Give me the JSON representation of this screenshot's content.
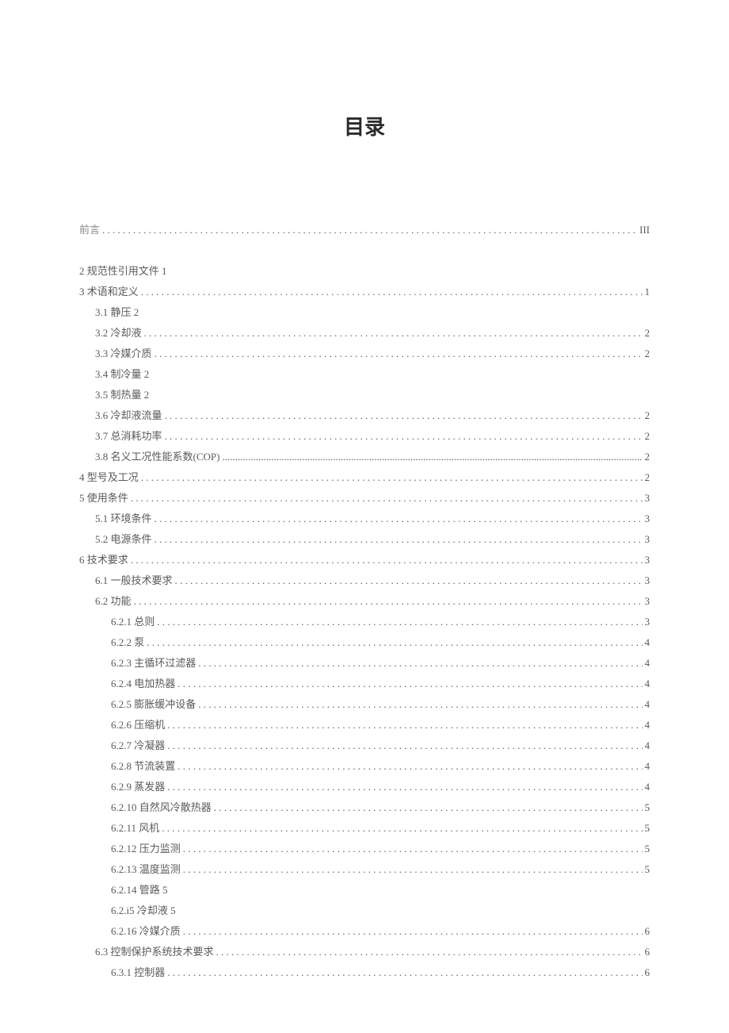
{
  "title": "目录",
  "entries": [
    {
      "label": "前言",
      "page": "III",
      "level": 0,
      "dots": true,
      "preface": true
    },
    {
      "label": "2 规范性引用文件 1",
      "page": "",
      "level": 0,
      "dots": false
    },
    {
      "label": "3 术语和定义",
      "page": "1",
      "level": 0,
      "dots": true
    },
    {
      "label": "3.1 静压 2",
      "page": "",
      "level": 1,
      "dots": false
    },
    {
      "label": "3.2 冷却液",
      "page": "2",
      "level": 1,
      "dots": true
    },
    {
      "label": "3.3 冷媒介质",
      "page": "2",
      "level": 1,
      "dots": true
    },
    {
      "label": "3.4 制冷量 2",
      "page": "",
      "level": 1,
      "dots": false
    },
    {
      "label": "3.5 制热量 2",
      "page": "",
      "level": 1,
      "dots": false
    },
    {
      "label": "3.6 冷却液流量",
      "page": "2",
      "level": 1,
      "dots": true
    },
    {
      "label": "3.7 总消耗功率",
      "page": "2",
      "level": 1,
      "dots": true
    },
    {
      "label": "3.8 名义工况性能系数(COP)",
      "page": "2",
      "level": 1,
      "dots": true,
      "tight": true
    },
    {
      "label": "4 型号及工况",
      "page": "2",
      "level": 0,
      "dots": true
    },
    {
      "label": "5 使用条件",
      "page": "3",
      "level": 0,
      "dots": true
    },
    {
      "label": "5.1 环境条件",
      "page": "3",
      "level": 1,
      "dots": true
    },
    {
      "label": "5.2 电源条件",
      "page": "3",
      "level": 1,
      "dots": true
    },
    {
      "label": "6 技术要求",
      "page": "3",
      "level": 0,
      "dots": true
    },
    {
      "label": "6.1 一般技术要求",
      "page": "3",
      "level": 1,
      "dots": true
    },
    {
      "label": "6.2 功能",
      "page": "3",
      "level": 1,
      "dots": true
    },
    {
      "label": "6.2.1 总则",
      "page": "3",
      "level": 2,
      "dots": true
    },
    {
      "label": "6.2.2 泵",
      "page": "4",
      "level": 2,
      "dots": true
    },
    {
      "label": "6.2.3 主循环过滤器",
      "page": "4",
      "level": 2,
      "dots": true
    },
    {
      "label": "6.2.4 电加热器",
      "page": "4",
      "level": 2,
      "dots": true
    },
    {
      "label": "6.2.5 膨胀缓冲设备",
      "page": "4",
      "level": 2,
      "dots": true
    },
    {
      "label": "6.2.6 压缩机",
      "page": "4",
      "level": 2,
      "dots": true
    },
    {
      "label": "6.2.7 冷凝器",
      "page": "4",
      "level": 2,
      "dots": true
    },
    {
      "label": "6.2.8 节流装置",
      "page": "4",
      "level": 2,
      "dots": true
    },
    {
      "label": "6.2.9 蒸发器",
      "page": "4",
      "level": 2,
      "dots": true
    },
    {
      "label": "6.2.10 自然风冷散热器",
      "page": "5",
      "level": 2,
      "dots": true
    },
    {
      "label": "6.2.11 风机",
      "page": "5",
      "level": 2,
      "dots": true
    },
    {
      "label": "6.2.12 压力监测",
      "page": "5",
      "level": 2,
      "dots": true
    },
    {
      "label": "6.2.13 温度监测",
      "page": "5",
      "level": 2,
      "dots": true
    },
    {
      "label": "6.2.14 管路 5",
      "page": "",
      "level": 2,
      "dots": false
    },
    {
      "label": "6.2.i5 冷却液 5",
      "page": "",
      "level": 2,
      "dots": false
    },
    {
      "label": "6.2.16 冷媒介质",
      "page": "6",
      "level": 2,
      "dots": true
    },
    {
      "label": "6.3 控制保护系统技术要求",
      "page": "6",
      "level": 1,
      "dots": true
    },
    {
      "label": "6.3.1 控制器",
      "page": "6",
      "level": 2,
      "dots": true
    }
  ]
}
